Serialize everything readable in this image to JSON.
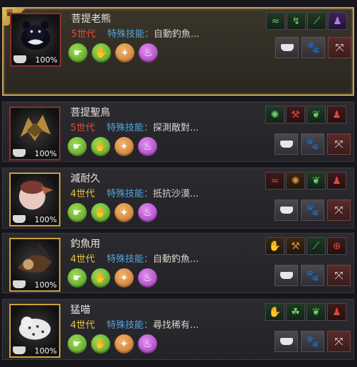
{
  "cards": [
    {
      "name": "菩提老熊",
      "generation": "5世代",
      "skill_label": "特殊技能：",
      "skill_value": "自動釣魚...",
      "percent": "100%",
      "selected": true,
      "skills": [
        {
          "icon": "fishing-rod-icon",
          "glyph": "≈",
          "color": "green"
        },
        {
          "icon": "fish-hook-icon",
          "glyph": "↯",
          "color": "green"
        },
        {
          "icon": "slash-icon",
          "glyph": "⟋",
          "color": "green"
        },
        {
          "icon": "party-icon",
          "glyph": "♟",
          "color": "purple"
        }
      ]
    },
    {
      "name": "菩提聖鳥",
      "generation": "5世代",
      "skill_label": "特殊技能：",
      "skill_value": "探測敵對...",
      "percent": "100%",
      "selected": false,
      "skills": [
        {
          "icon": "scorpion-icon",
          "glyph": "✺",
          "color": "green"
        },
        {
          "icon": "hammer-icon",
          "glyph": "⚒",
          "color": "red"
        },
        {
          "icon": "wing-icon",
          "glyph": "❦",
          "color": "green"
        },
        {
          "icon": "people-up-icon",
          "glyph": "♟",
          "color": "red"
        }
      ]
    },
    {
      "name": "減耐久",
      "generation": "4世代",
      "skill_label": "特殊技能：",
      "skill_value": "抵抗沙漠...",
      "percent": "100%",
      "selected": false,
      "skills": [
        {
          "icon": "fishing-rod-icon",
          "glyph": "≈",
          "color": "red"
        },
        {
          "icon": "scorpion-icon",
          "glyph": "✺",
          "color": "orange"
        },
        {
          "icon": "wing-icon",
          "glyph": "❦",
          "color": "green"
        },
        {
          "icon": "people-up-icon",
          "glyph": "♟",
          "color": "red"
        }
      ]
    },
    {
      "name": "釣魚用",
      "generation": "4世代",
      "skill_label": "特殊技能：",
      "skill_value": "自動釣魚...",
      "percent": "100%",
      "selected": false,
      "skills": [
        {
          "icon": "hand-icon",
          "glyph": "✋",
          "color": "orange"
        },
        {
          "icon": "hammer-icon",
          "glyph": "⚒",
          "color": "orange"
        },
        {
          "icon": "slash-icon",
          "glyph": "⟋",
          "color": "green"
        },
        {
          "icon": "compass-icon",
          "glyph": "⊕",
          "color": "red"
        }
      ]
    },
    {
      "name": "猛喵",
      "generation": "4世代",
      "skill_label": "特殊技能：",
      "skill_value": "尋找稀有...",
      "percent": "100%",
      "selected": false,
      "skills": [
        {
          "icon": "hand-icon",
          "glyph": "✋",
          "color": "green"
        },
        {
          "icon": "clover-icon",
          "glyph": "☘",
          "color": "green"
        },
        {
          "icon": "wing-icon",
          "glyph": "❦",
          "color": "green"
        },
        {
          "icon": "people-up-icon",
          "glyph": "♟",
          "color": "red"
        }
      ]
    }
  ],
  "trait_circles": [
    {
      "icon": "hand-grab-icon",
      "glyph": "☛",
      "color": "green"
    },
    {
      "icon": "paw-grab-icon",
      "glyph": "✋",
      "color": "green"
    },
    {
      "icon": "compass-star-icon",
      "glyph": "✦",
      "color": "orange"
    },
    {
      "icon": "potion-icon",
      "glyph": "♨",
      "color": "purple"
    }
  ],
  "actions": {
    "feed_icon": "feed-bowl-icon",
    "paw_glyph": "🐾",
    "release_glyph": "⤧"
  },
  "crown_glyph": "♛",
  "colors": {
    "selected_border": "#c9a45a",
    "generation_5": "#e84a3a",
    "generation_4": "#e9c43a",
    "skill_label": "#4fa8e0"
  }
}
